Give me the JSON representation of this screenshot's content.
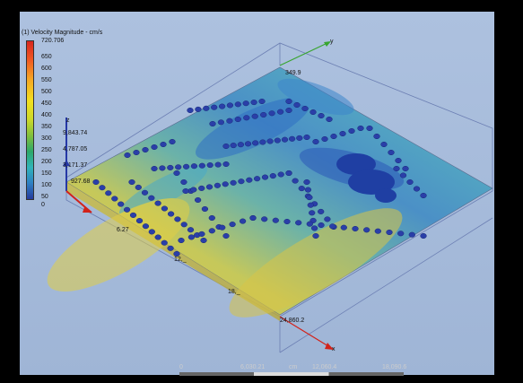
{
  "legend": {
    "title": "(1) Velocity Magnitude - cm/s",
    "max_label": "720.706",
    "ticks": [
      "650",
      "600",
      "550",
      "500",
      "450",
      "400",
      "350",
      "300",
      "250",
      "200",
      "150",
      "100",
      "50",
      "0"
    ]
  },
  "axis_labels": {
    "z": "z",
    "y": "y",
    "x": "x",
    "corner_top": "349.9",
    "left_top": "9,843.74",
    "left_mid": "4,787.05",
    "left_low": "3,171.37",
    "left_bottom": "927.68",
    "left_front": "6.27",
    "front_a": "12,_",
    "front_b": "18,_",
    "front_end": "24,860.2"
  },
  "scale": {
    "labels": [
      "0",
      "6,030.21",
      "cm",
      "12,060.4",
      "18,090.6"
    ]
  }
}
